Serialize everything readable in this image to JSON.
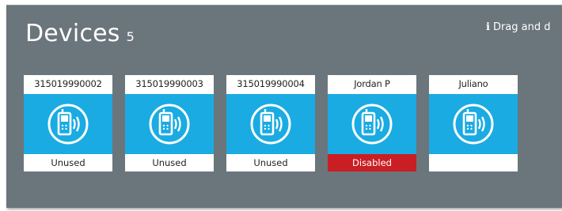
{
  "panel": {
    "title": "Devices",
    "count": "5",
    "hint_icon": "info-icon",
    "hint": "Drag and d"
  },
  "devices": [
    {
      "id": "315019990002",
      "status": "Unused",
      "icon": "mobile-phone-signal-icon"
    },
    {
      "id": "315019990003",
      "status": "Unused",
      "icon": "mobile-phone-signal-icon"
    },
    {
      "id": "315019990004",
      "status": "Unused",
      "icon": "mobile-phone-signal-icon"
    },
    {
      "id": "Jordan P",
      "status": "Disabled",
      "icon": "mobile-phone-signal-icon"
    },
    {
      "id": "Juliano",
      "status": "",
      "icon": "mobile-phone-signal-icon"
    }
  ],
  "colors": {
    "panel_bg": "#6b757c",
    "card_accent": "#1aabe2",
    "disabled": "#c91f24"
  }
}
